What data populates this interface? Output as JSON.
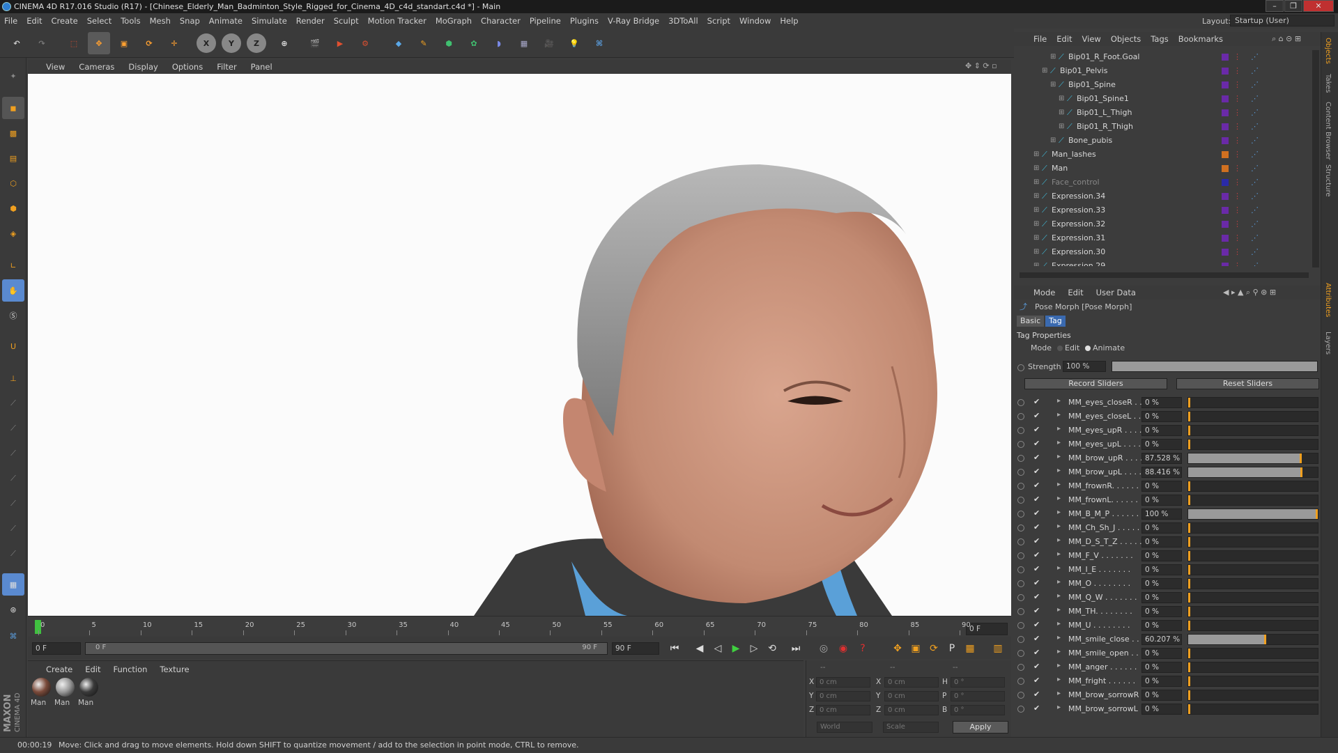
{
  "window": {
    "title": "CINEMA 4D R17.016 Studio (R17) - [Chinese_Elderly_Man_Badminton_Style_Rigged_for_Cinema_4D_c4d_standart.c4d *] - Main",
    "layout_label": "Layout:",
    "layout_value": "Startup (User)"
  },
  "menu": [
    "File",
    "Edit",
    "Create",
    "Select",
    "Tools",
    "Mesh",
    "Snap",
    "Animate",
    "Simulate",
    "Render",
    "Sculpt",
    "Motion Tracker",
    "MoGraph",
    "Character",
    "Pipeline",
    "Plugins",
    "V-Ray Bridge",
    "3DToAll",
    "Script",
    "Window",
    "Help"
  ],
  "viewport_menu": [
    "View",
    "Cameras",
    "Display",
    "Options",
    "Filter",
    "Panel"
  ],
  "timeline": {
    "ticks": [
      "0",
      "5",
      "10",
      "15",
      "20",
      "25",
      "30",
      "35",
      "40",
      "45",
      "50",
      "55",
      "60",
      "65",
      "70",
      "75",
      "80",
      "85",
      "90"
    ],
    "current_frame": "0 F",
    "start_field": "0 F",
    "range_start": "0 F",
    "range_end": "90 F",
    "end_field": "90 F"
  },
  "materials": {
    "menu": [
      "Create",
      "Edit",
      "Function",
      "Texture"
    ],
    "items": [
      {
        "label": "Man",
        "color": "#7a4a3a"
      },
      {
        "label": "Man",
        "color": "#9a9a9a"
      },
      {
        "label": "Man",
        "color": "#3a3a3a"
      }
    ]
  },
  "coordinates": {
    "header_left": "--",
    "header_mid": "--",
    "header_right": "--",
    "rows": [
      {
        "a": "X",
        "v1": "0 cm",
        "b": "X",
        "v2": "0 cm",
        "c": "H",
        "v3": "0 °"
      },
      {
        "a": "Y",
        "v1": "0 cm",
        "b": "Y",
        "v2": "0 cm",
        "c": "P",
        "v3": "0 °"
      },
      {
        "a": "Z",
        "v1": "0 cm",
        "b": "Z",
        "v2": "0 cm",
        "c": "B",
        "v3": "0 °"
      }
    ],
    "world": "World",
    "scale": "Scale",
    "apply": "Apply"
  },
  "status": {
    "time": "00:00:19",
    "message": "Move: Click and drag to move elements. Hold down SHIFT to quantize movement / add to the selection in point mode, CTRL to remove."
  },
  "object_manager": {
    "menu": [
      "File",
      "Edit",
      "View",
      "Objects",
      "Tags",
      "Bookmarks"
    ],
    "rows": [
      {
        "name": "Bip01_R_Foot.Goal",
        "indent": 4,
        "tag": "#6a2aa8"
      },
      {
        "name": "Bip01_Pelvis",
        "indent": 3,
        "tag": "#6a2aa8"
      },
      {
        "name": "Bip01_Spine",
        "indent": 4,
        "tag": "#6a2aa8"
      },
      {
        "name": "Bip01_Spine1",
        "indent": 5,
        "tag": "#6a2aa8"
      },
      {
        "name": "Bip01_L_Thigh",
        "indent": 5,
        "tag": "#6a2aa8"
      },
      {
        "name": "Bip01_R_Thigh",
        "indent": 5,
        "tag": "#6a2aa8"
      },
      {
        "name": "Bone_pubis",
        "indent": 4,
        "tag": "#6a2aa8"
      },
      {
        "name": "Man_lashes",
        "indent": 2,
        "tag": "#d07020"
      },
      {
        "name": "Man",
        "indent": 2,
        "tag": "#d07020"
      },
      {
        "name": "Face_control",
        "indent": 2,
        "tag": "#2a2aa8"
      },
      {
        "name": "Expression.34",
        "indent": 2,
        "tag": "#6a2aa8"
      },
      {
        "name": "Expression.33",
        "indent": 2,
        "tag": "#6a2aa8"
      },
      {
        "name": "Expression.32",
        "indent": 2,
        "tag": "#6a2aa8"
      },
      {
        "name": "Expression.31",
        "indent": 2,
        "tag": "#6a2aa8"
      },
      {
        "name": "Expression.30",
        "indent": 2,
        "tag": "#6a2aa8"
      },
      {
        "name": "Expression.29",
        "indent": 2,
        "tag": "#6a2aa8"
      }
    ]
  },
  "attributes": {
    "menu": [
      "Mode",
      "Edit",
      "User Data"
    ],
    "title": "Pose Morph [Pose Morph]",
    "tabs": [
      "Basic",
      "Tag"
    ],
    "section": "Tag Properties",
    "mode_label": "Mode",
    "mode_edit": "Edit",
    "mode_animate": "Animate",
    "strength_label": "Strength",
    "strength_value": "100 %",
    "strength_fraction": 1.0,
    "record_button": "Record Sliders",
    "reset_button": "Reset Sliders",
    "sliders": [
      {
        "name": "MM_eyes_closeR . .",
        "value": "0 %",
        "fraction": 0
      },
      {
        "name": "MM_eyes_closeL . .",
        "value": "0 %",
        "fraction": 0
      },
      {
        "name": "MM_eyes_upR . . . .",
        "value": "0 %",
        "fraction": 0
      },
      {
        "name": "MM_eyes_upL . . . .",
        "value": "0 %",
        "fraction": 0
      },
      {
        "name": "MM_brow_upR . . . .",
        "value": "87.528 %",
        "fraction": 0.87528
      },
      {
        "name": "MM_brow_upL . . . .",
        "value": "88.416 %",
        "fraction": 0.88416
      },
      {
        "name": "MM_frownR. . . . . .",
        "value": "0 %",
        "fraction": 0
      },
      {
        "name": "MM_frownL. . . . . .",
        "value": "0 %",
        "fraction": 0
      },
      {
        "name": "MM_B_M_P . . . . . .",
        "value": "100 %",
        "fraction": 1.0
      },
      {
        "name": "MM_Ch_Sh_J . . . . .",
        "value": "0 %",
        "fraction": 0
      },
      {
        "name": "MM_D_S_T_Z . . . . .",
        "value": "0 %",
        "fraction": 0
      },
      {
        "name": "MM_F_V . . . . . . .",
        "value": "0 %",
        "fraction": 0
      },
      {
        "name": "MM_I_E . . . . . . .",
        "value": "0 %",
        "fraction": 0
      },
      {
        "name": "MM_O . . . . . . . .",
        "value": "0 %",
        "fraction": 0
      },
      {
        "name": "MM_Q_W . . . . . . .",
        "value": "0 %",
        "fraction": 0
      },
      {
        "name": "MM_TH. . . . . . . .",
        "value": "0 %",
        "fraction": 0
      },
      {
        "name": "MM_U . . . . . . . .",
        "value": "0 %",
        "fraction": 0
      },
      {
        "name": "MM_smile_close . . .",
        "value": "60.207 %",
        "fraction": 0.60207
      },
      {
        "name": "MM_smile_open . . .",
        "value": "0 %",
        "fraction": 0
      },
      {
        "name": "MM_anger . . . . . .",
        "value": "0 %",
        "fraction": 0
      },
      {
        "name": "MM_fright . . . . . .",
        "value": "0 %",
        "fraction": 0
      },
      {
        "name": "MM_brow_sorrowR",
        "value": "0 %",
        "fraction": 0
      },
      {
        "name": "MM_brow_sorrowL",
        "value": "0 %",
        "fraction": 0
      }
    ]
  },
  "side_tabs": [
    "Objects",
    "Takes",
    "Content Browser",
    "Structure",
    "Attributes",
    "Layers"
  ],
  "brand_lines": [
    "MAXON",
    "CINEMA 4D"
  ]
}
